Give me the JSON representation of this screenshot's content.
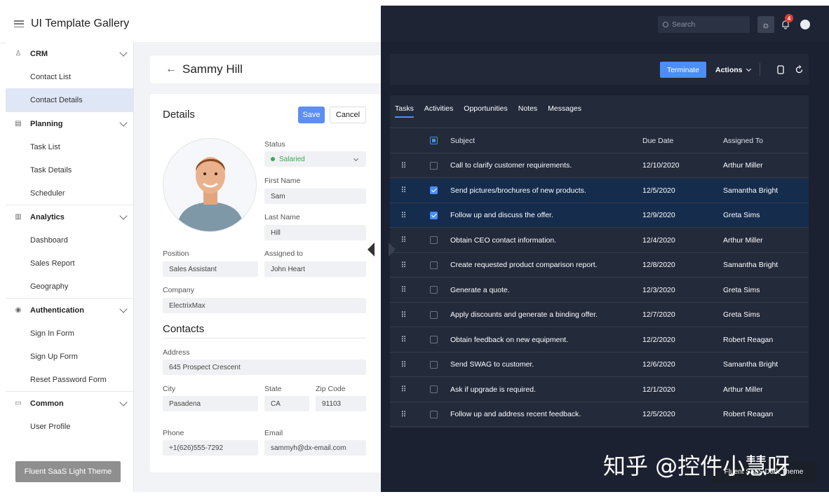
{
  "app": {
    "title": "UI Template Gallery"
  },
  "sidebar": {
    "groups": [
      {
        "label": "CRM",
        "icon": "person-icon",
        "items": [
          "Contact List",
          "Contact Details"
        ]
      },
      {
        "label": "Planning",
        "icon": "calendar-icon",
        "items": [
          "Task List",
          "Task Details",
          "Scheduler"
        ]
      },
      {
        "label": "Analytics",
        "icon": "chart-icon",
        "items": [
          "Dashboard",
          "Sales Report",
          "Geography"
        ]
      },
      {
        "label": "Authentication",
        "icon": "user-circle-icon",
        "items": [
          "Sign In Form",
          "Sign Up Form",
          "Reset Password Form"
        ]
      },
      {
        "label": "Common",
        "icon": "inbox-icon",
        "items": [
          "User Profile"
        ]
      }
    ],
    "active_item": "Contact Details"
  },
  "theme_buttons": {
    "light": "Fluent SaaS Light Theme",
    "dark": "Fluent SaaS Dark Theme"
  },
  "contact": {
    "name": "Sammy Hill",
    "details_title": "Details",
    "save": "Save",
    "cancel": "Cancel",
    "labels": {
      "status": "Status",
      "first_name": "First Name",
      "last_name": "Last Name",
      "position": "Position",
      "assigned_to": "Assigned to",
      "company": "Company",
      "address": "Address",
      "city": "City",
      "state": "State",
      "zip": "Zip Code",
      "phone": "Phone",
      "email": "Email"
    },
    "values": {
      "status": "Salaried",
      "first_name": "Sam",
      "last_name": "Hill",
      "position": "Sales Assistant",
      "assigned_to": "John Heart",
      "company": "ElectrixMax",
      "address": "645 Prospect Crescent",
      "city": "Pasadena",
      "state": "CA",
      "zip": "91103",
      "phone": "+1(626)555-7292",
      "email": "sammyh@dx-email.com"
    },
    "contacts_title": "Contacts",
    "status_color": "#3aa655"
  },
  "dark_header": {
    "search_placeholder": "Search",
    "notifications": "4"
  },
  "toolbar": {
    "terminate": "Terminate",
    "actions": "Actions"
  },
  "tabs": [
    "Tasks",
    "Activities",
    "Opportunities",
    "Notes",
    "Messages"
  ],
  "grid": {
    "columns": [
      "Subject",
      "Due Date",
      "Assigned To"
    ],
    "rows": [
      {
        "subject": "Call to clarify customer requirements.",
        "due": "12/10/2020",
        "assigned": "Arthur Miller",
        "checked": false
      },
      {
        "subject": "Send pictures/brochures of new products.",
        "due": "12/5/2020",
        "assigned": "Samantha Bright",
        "checked": true
      },
      {
        "subject": "Follow up and discuss the offer.",
        "due": "12/9/2020",
        "assigned": "Greta Sims",
        "checked": true
      },
      {
        "subject": "Obtain CEO contact information.",
        "due": "12/4/2020",
        "assigned": "Arthur Miller",
        "checked": false
      },
      {
        "subject": "Create requested product comparison report.",
        "due": "12/8/2020",
        "assigned": "Samantha Bright",
        "checked": false
      },
      {
        "subject": "Generate a quote.",
        "due": "12/3/2020",
        "assigned": "Greta Sims",
        "checked": false
      },
      {
        "subject": "Apply discounts and generate a binding offer.",
        "due": "12/7/2020",
        "assigned": "Greta Sims",
        "checked": false
      },
      {
        "subject": "Obtain feedback on new equipment.",
        "due": "12/2/2020",
        "assigned": "Robert Reagan",
        "checked": false
      },
      {
        "subject": "Send SWAG to customer.",
        "due": "12/6/2020",
        "assigned": "Samantha Bright",
        "checked": false
      },
      {
        "subject": "Ask if upgrade is required.",
        "due": "12/1/2020",
        "assigned": "Arthur Miller",
        "checked": false
      },
      {
        "subject": "Follow up and address recent feedback.",
        "due": "12/5/2020",
        "assigned": "Robert Reagan",
        "checked": false
      }
    ]
  },
  "watermark": "知乎 @控件小慧呀",
  "colors": {
    "accent": "#4b8ef5",
    "dark_bg": "#1b2130",
    "light_active": "#dfe6f5"
  }
}
